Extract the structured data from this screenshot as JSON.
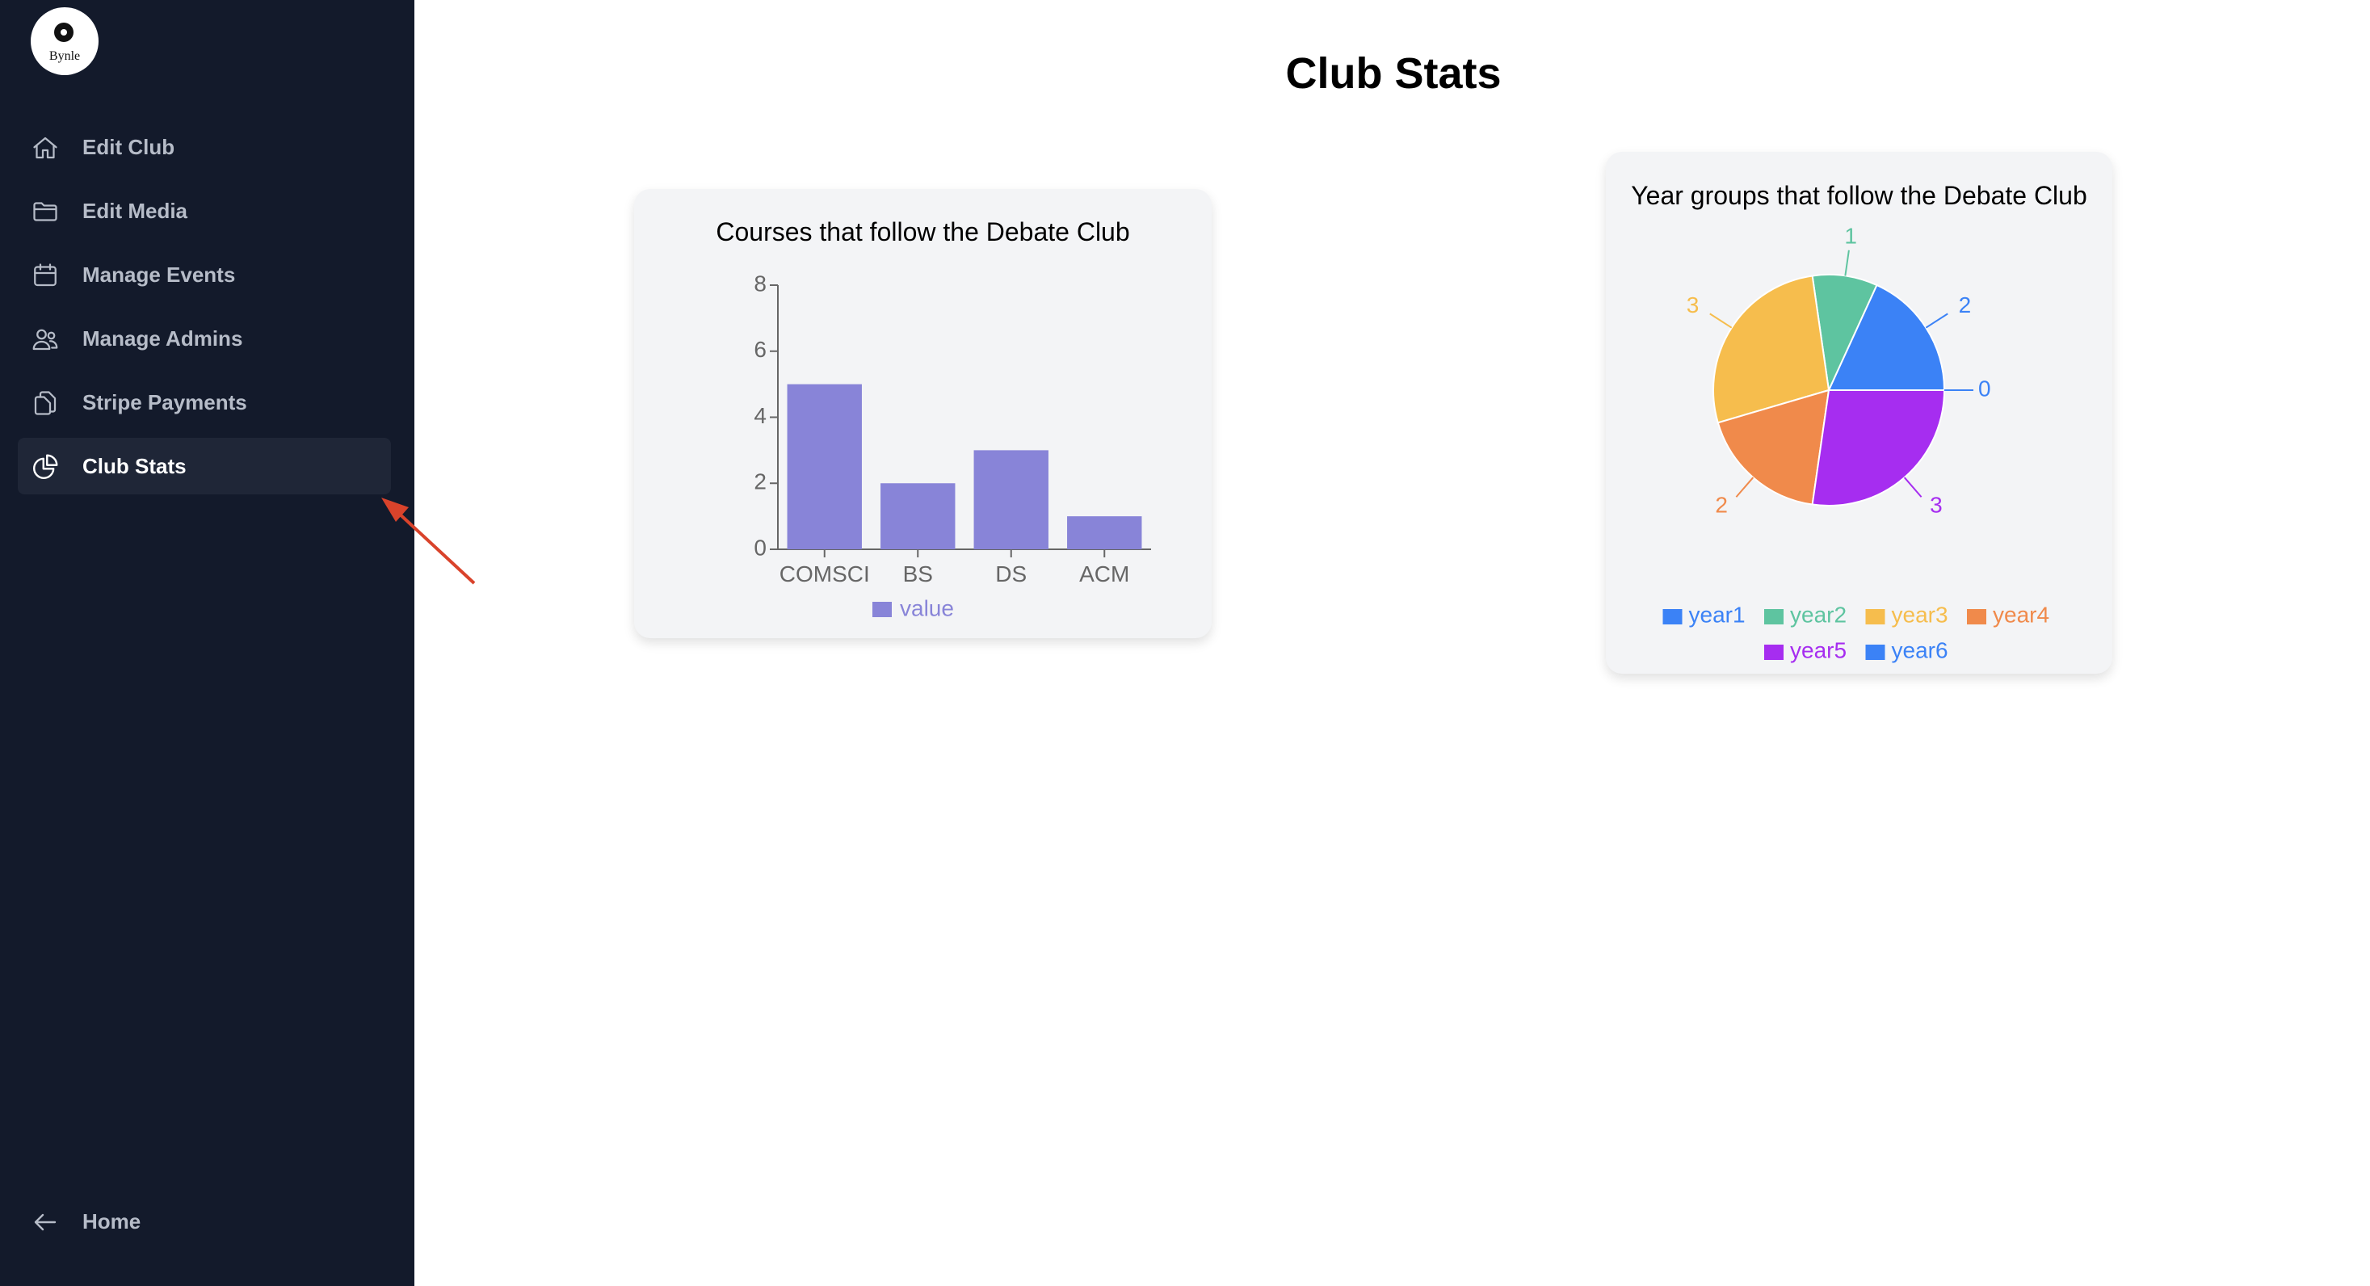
{
  "app": {
    "logo_text": "Bynle"
  },
  "sidebar": {
    "items": [
      {
        "label": "Edit Club",
        "icon": "home-icon"
      },
      {
        "label": "Edit Media",
        "icon": "folder-icon"
      },
      {
        "label": "Manage Events",
        "icon": "calendar-icon"
      },
      {
        "label": "Manage Admins",
        "icon": "users-icon"
      },
      {
        "label": "Stripe Payments",
        "icon": "documents-icon"
      },
      {
        "label": "Club Stats",
        "icon": "pie-chart-icon",
        "active": true
      }
    ],
    "footer": {
      "label": "Home",
      "icon": "arrow-left-icon"
    }
  },
  "main": {
    "title": "Club Stats"
  },
  "colors": {
    "sidebar_bg": "#131a2b",
    "bar": "#8884d8",
    "annotation_arrow": "#d9432b"
  },
  "chart_data": [
    {
      "type": "bar",
      "title": "Courses that follow the Debate Club",
      "categories": [
        "COMSCI",
        "BS",
        "DS",
        "ACM"
      ],
      "series": [
        {
          "name": "value",
          "values": [
            5,
            2,
            3,
            1
          ]
        }
      ],
      "ylim": [
        0,
        8
      ],
      "yticks": [
        0,
        2,
        4,
        6,
        8
      ],
      "legend": "bottom",
      "grid": false
    },
    {
      "type": "pie",
      "title": "Year groups that follow the Debate Club",
      "labels": [
        "year1",
        "year2",
        "year3",
        "year4",
        "year5",
        "year6"
      ],
      "values": [
        2,
        1,
        3,
        2,
        3,
        0
      ],
      "colors": [
        "#3b82f6",
        "#5ec4a0",
        "#f6bd4d",
        "#f08a4b",
        "#a62df0",
        "#3b82f6"
      ],
      "legend": "bottom"
    }
  ]
}
